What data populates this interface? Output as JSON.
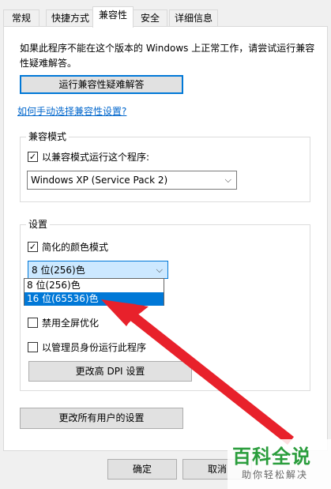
{
  "tabs": [
    {
      "label": "常规"
    },
    {
      "label": "快捷方式"
    },
    {
      "label": "兼容性"
    },
    {
      "label": "安全"
    },
    {
      "label": "详细信息"
    }
  ],
  "intro_text": "如果此程序不能在这个版本的 Windows 上正常工作，请尝试运行兼容性疑难解答。",
  "troubleshoot_button": "运行兼容性疑难解答",
  "manual_link": "如何手动选择兼容性设置?",
  "compat_mode": {
    "group_label": "兼容模式",
    "checkbox_label": "以兼容模式运行这个程序:",
    "checked": true,
    "selected_os": "Windows XP (Service Pack 2)"
  },
  "settings": {
    "group_label": "设置",
    "reduced_color_label": "简化的颜色模式",
    "reduced_color_checked": true,
    "color_select_value": "8 位(256)色",
    "color_options": [
      "8 位(256)色",
      "16 位(65536)色"
    ],
    "highlighted_option_index": 1,
    "disable_fullscreen_label": "禁用全屏优化",
    "disable_fullscreen_checked": false,
    "run_as_admin_label": "以管理员身份运行此程序",
    "run_as_admin_checked": false,
    "dpi_button": "更改高 DPI 设置"
  },
  "all_users_button": "更改所有用户的设置",
  "footer": {
    "ok": "确定",
    "cancel": "取消"
  },
  "watermark": {
    "title": "百科全说",
    "subtitle": "助你轻松解决"
  },
  "colors": {
    "accent": "#0078d7",
    "arrow": "#e8212b",
    "watermark_green": "#2a9d3c"
  }
}
